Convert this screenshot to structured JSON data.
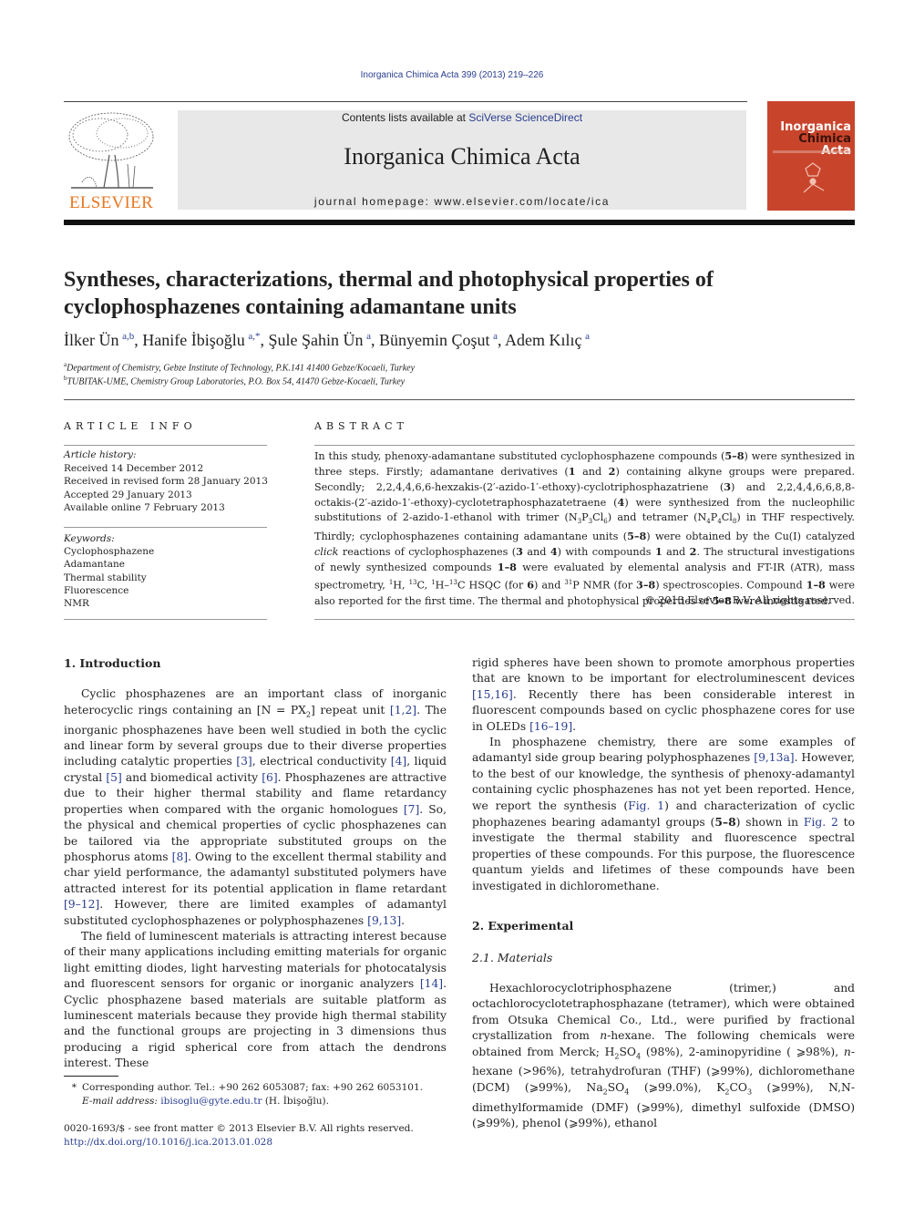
{
  "citation": "Inorganica Chimica Acta 399 (2013) 219–226",
  "masthead": {
    "contents_prefix": "Contents lists available at ",
    "contents_link": "SciVerse ScienceDirect",
    "journal_name": "Inorganica Chimica Acta",
    "homepage": "journal homepage: www.elsevier.com/locate/ica"
  },
  "publisher": {
    "name": "ELSEVIER",
    "color": "#e87722"
  },
  "cover": {
    "line1": "Inorganica",
    "line2a": "Chimica",
    "line2b": "Acta",
    "color": "#c8452c"
  },
  "article": {
    "title": "Syntheses, characterizations, thermal and photophysical properties of cyclophosphazenes containing adamantane units",
    "authors": [
      {
        "name": "İlker Ün",
        "sup": "a,b",
        "sep": ", "
      },
      {
        "name": "Hanife İbişoğlu",
        "sup": "a,*",
        "sep": ", "
      },
      {
        "name": "Şule Şahin Ün",
        "sup": "a",
        "sep": ", "
      },
      {
        "name": "Bünyemin Çoşut",
        "sup": "a",
        "sep": ", "
      },
      {
        "name": "Adem Kılıç",
        "sup": "a",
        "sep": ""
      }
    ],
    "affiliations": [
      {
        "mark": "a",
        "text": "Department of Chemistry, Gebze Institute of Technology, P.K.141 41400 Gebze/Kocaeli, Turkey"
      },
      {
        "mark": "b",
        "text": "TUBITAK-UME, Chemistry Group Laboratories, P.O. Box 54, 41470 Gebze-Kocaeli, Turkey"
      }
    ]
  },
  "article_info": {
    "heading": "ARTICLE INFO",
    "history_label": "Article history:",
    "history": [
      "Received 14 December 2012",
      "Received in revised form 28 January 2013",
      "Accepted 29 January 2013",
      "Available online 7 February 2013"
    ],
    "keywords_label": "Keywords:",
    "keywords": [
      "Cyclophosphazene",
      "Adamantane",
      "Thermal stability",
      "Fluorescence",
      "NMR"
    ]
  },
  "abstract": {
    "heading": "ABSTRACT",
    "t1": "In this study, phenoxy-adamantane substituted cyclophosphazene compounds (",
    "b1": "5–8",
    "t2": ") were synthesized in three steps. Firstly; adamantane derivatives (",
    "b2": "1",
    "t3": " and ",
    "b3": "2",
    "t4": ") containing alkyne groups were prepared. Secondly; 2,2,4,4,6,6-hexzakis-(2′-azido-1′-ethoxy)-cyclotriphosphazatriene (",
    "b4": "3",
    "t5": ") and 2,2,4,4,6,6,8,8-octakis-(2′-azido-1′-ethoxy)-cyclotetraphosphazatetraene (",
    "b5": "4",
    "t6": ") were synthesized from the nucleophilic substitutions of 2-azido-1-ethanol with trimer (N",
    "s1": "3",
    "t7": "P",
    "s2": "3",
    "t8": "Cl",
    "s3": "6",
    "t9": ") and tetramer (N",
    "s4": "4",
    "t10": "P",
    "s5": "4",
    "t11": "Cl",
    "s6": "8",
    "t12": ") in THF respectively. Thirdly; cyclophosphazenes containing adamantane units (",
    "b6": "5–8",
    "t13": ") were obtained by the Cu(I) catalyzed ",
    "i1": "click",
    "t14": " reactions of cyclophosphazenes (",
    "b7": "3",
    "t15": " and ",
    "b8": "4",
    "t16": ") with compounds ",
    "b9": "1",
    "t17": " and ",
    "b10": "2",
    "t18": ". The structural investigations of newly synthesized compounds ",
    "b11": "1–8",
    "t19": " were evaluated by elemental analysis and FT-IR (ATR), mass spectrometry, ",
    "p1": "1",
    "t20": "H, ",
    "p2": "13",
    "t21": "C, ",
    "p3": "1",
    "t22": "H–",
    "p4": "13",
    "t23": "C HSQC (for ",
    "b12": "6",
    "t24": ") and ",
    "p5": "31",
    "t25": "P NMR (for ",
    "b13": "3–8",
    "t26": ") spectroscopies. Compound ",
    "b14": "1–8",
    "t27": " were also reported for the first time. The thermal and photophysical properties of ",
    "b15": "5–8",
    "t28": " were investigated.",
    "copyright": "© 2013 Elsevier B.V. All rights reserved."
  },
  "intro": {
    "heading": "1. Introduction",
    "p1": {
      "a": "Cyclic phosphazenes are an important class of inorganic heterocyclic rings containing an [N = PX",
      "sub": "2",
      "b": "] repeat unit ",
      "r1": "[1,2]",
      "c": ". The inorganic phosphazenes have been well studied in both the cyclic and linear form by several groups due to their diverse properties including catalytic properties ",
      "r2": "[3]",
      "d": ", electrical conductivity ",
      "r3": "[4]",
      "e": ", liquid crystal ",
      "r4": "[5]",
      "f": " and biomedical activity ",
      "r5": "[6]",
      "g": ". Phosphazenes are attractive due to their higher thermal stability and flame retardancy properties when compared with the organic homologues ",
      "r6": "[7]",
      "h": ". So, the physical and chemical properties of cyclic phosphazenes can be tailored via the appropriate substituted groups on the phosphorus atoms ",
      "r7": "[8]",
      "i": ". Owing to the excellent thermal stability and char yield performance, the adamantyl substituted polymers have attracted interest for its potential application in flame retardant ",
      "r8": "[9–12]",
      "j": ". However, there are limited examples of adamantyl substituted cyclophosphazenes or polyphosphazenes ",
      "r9": "[9,13]",
      "k": "."
    },
    "p2": {
      "a": "The field of luminescent materials is attracting interest because of their many applications including emitting materials for organic light emitting diodes, light harvesting materials for photocatalysis and fluorescent sensors for organic or inorganic analyzers ",
      "r1": "[14]",
      "b": ". Cyclic phosphazene based materials are suitable platform as luminescent materials because they provide high thermal stability and the functional groups are projecting in 3 dimensions thus producing a rigid spherical core from attach the dendrons interest. These rigid spheres have been shown to promote amorphous properties that are known to be important for electroluminescent devices ",
      "r2": "[15,16]",
      "c": ". Recently there has been considerable interest in fluorescent compounds based on cyclic phosphazene cores for use in OLEDs ",
      "r3": "[16–19]",
      "d": "."
    },
    "p3": {
      "a": "In phosphazene chemistry, there are some examples of adamantyl side group bearing polyphosphazenes ",
      "r1": "[9,13a]",
      "b": ". However, to the best of our knowledge, the synthesis of phenoxy-adamantyl containing cyclic phosphazenes has not yet been reported. Hence, we report the synthesis (",
      "r2": "Fig. 1",
      "c": ") and characterization of cyclic phophazenes bearing adamantyl groups (",
      "bold": "5–8",
      "d": ") shown in ",
      "r3": "Fig. 2",
      "e": " to investigate the thermal stability and fluorescence spectral properties of these compounds. For this purpose, the fluorescence quantum yields and lifetimes of these compounds have been investigated in dichloromethane."
    }
  },
  "experimental": {
    "heading": "2. Experimental",
    "subheading": "2.1. Materials",
    "p1": {
      "a": "Hexachlorocyclotriphosphazene (trimer,) and octachlorocyclotetraphosphazane (tetramer), which were obtained from Otsuka Chemical Co., Ltd., were purified by fractional crystallization from ",
      "n1": "n",
      "b": "-hexane. The following chemicals were obtained from Merck; H",
      "s1": "2",
      "c": "SO",
      "s2": "4",
      "d": " (98%), 2-aminopyridine ( ⩾98%), ",
      "n2": "n",
      "e": "-hexane (>96%), tetrahydrofuran (THF) (⩾99%), dichloromethane (DCM) (⩾99%), Na",
      "s3": "2",
      "f": "SO",
      "s4": "4",
      "g": " (⩾99.0%), K",
      "s5": "2",
      "h": "CO",
      "s6": "3",
      "i": " (⩾99%), N,N-dimethylformamide (DMF) (⩾99%), dimethyl sulfoxide (DMSO) (⩾99%), phenol (⩾99%), ethanol"
    }
  },
  "footnote": {
    "star": "*",
    "text": "Corresponding author. Tel.: +90 262 6053087; fax: +90 262 6053101.",
    "email_label": "E-mail address:",
    "email": "ibisoglu@gyte.edu.tr",
    "email_suffix": " (H. İbişoğlu)."
  },
  "issn": "0020-1693/$ - see front matter © 2013 Elsevier B.V. All rights reserved.",
  "doi": "http://dx.doi.org/10.1016/j.ica.2013.01.028"
}
